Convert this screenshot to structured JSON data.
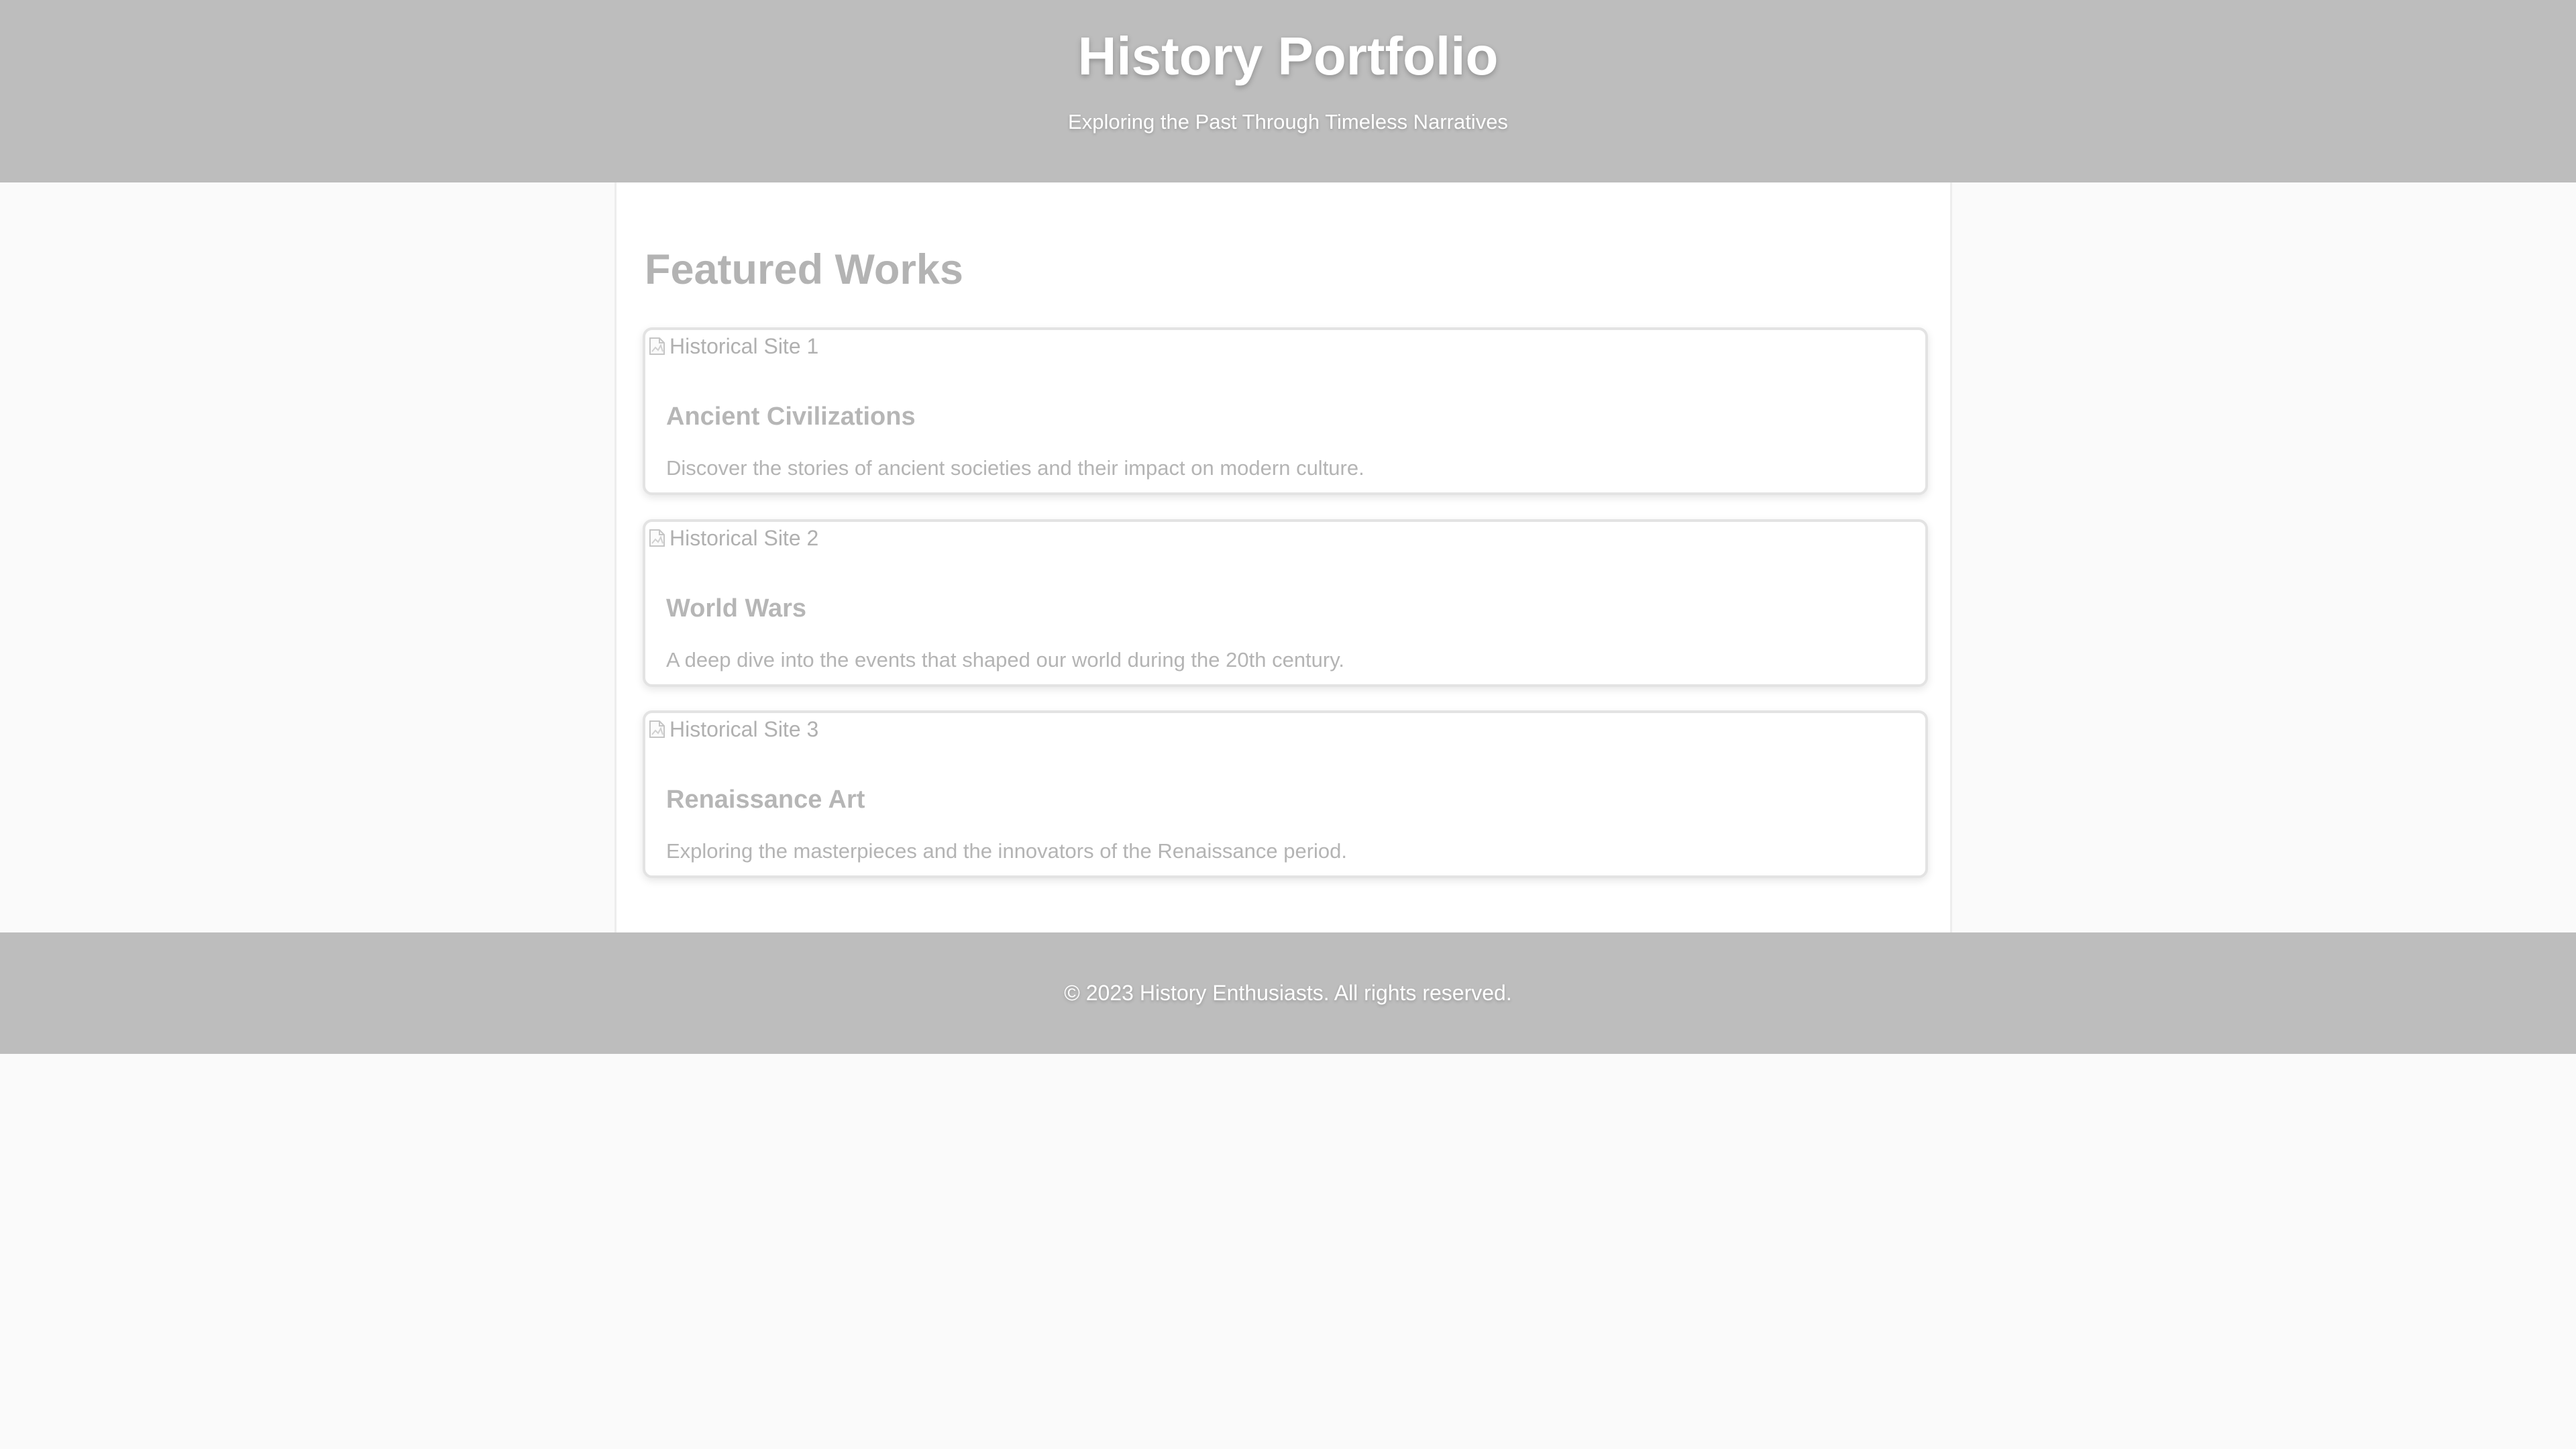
{
  "header": {
    "title": "History Portfolio",
    "tagline": "Exploring the Past Through Timeless Narratives"
  },
  "main": {
    "section_title": "Featured Works",
    "works": [
      {
        "image_alt": "Historical Site 1",
        "title": "Ancient Civilizations",
        "description": "Discover the stories of ancient societies and their impact on modern culture."
      },
      {
        "image_alt": "Historical Site 2",
        "title": "World Wars",
        "description": "A deep dive into the events that shaped our world during the 20th century."
      },
      {
        "image_alt": "Historical Site 3",
        "title": "Renaissance Art",
        "description": "Exploring the masterpieces and the innovators of the Renaissance period."
      }
    ]
  },
  "footer": {
    "copyright": "© 2023 History Enthusiasts. All rights reserved."
  },
  "colors": {
    "header_background": "#bdbdbd",
    "page_background": "#fafafa",
    "content_background": "#ffffff",
    "muted_text": "#b4b4b4",
    "header_text": "#ffffff"
  },
  "icons": {
    "image_placeholder": "broken-image-icon"
  }
}
